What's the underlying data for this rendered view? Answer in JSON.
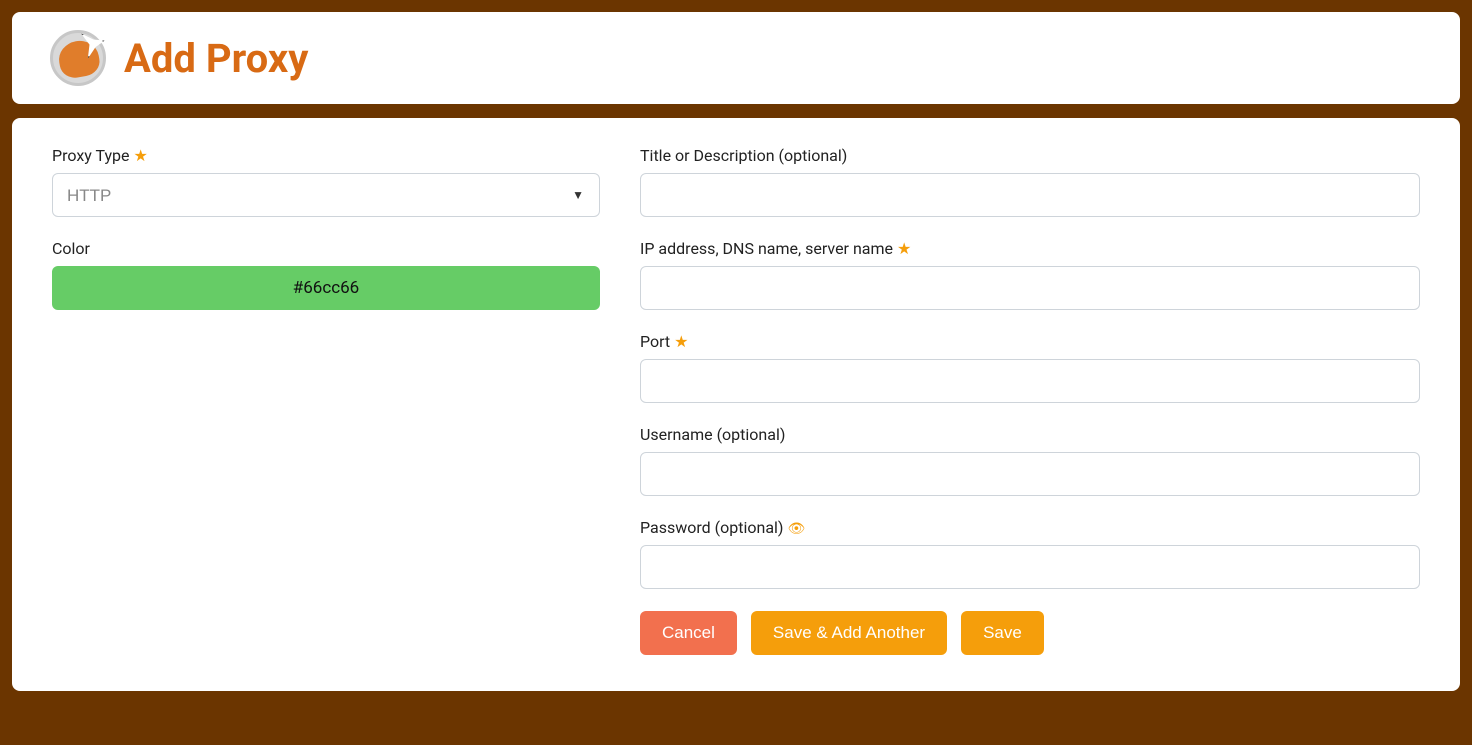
{
  "header": {
    "title": "Add Proxy"
  },
  "form": {
    "left": {
      "proxy_type": {
        "label": "Proxy Type",
        "required": true,
        "value": "HTTP"
      },
      "color": {
        "label": "Color",
        "value": "#66cc66",
        "swatch_bg": "#66cc66"
      }
    },
    "right": {
      "title": {
        "label": "Title or Description (optional)",
        "required": false,
        "value": ""
      },
      "address": {
        "label": "IP address, DNS name, server name",
        "required": true,
        "value": ""
      },
      "port": {
        "label": "Port",
        "required": true,
        "value": ""
      },
      "username": {
        "label": "Username (optional)",
        "required": false,
        "value": ""
      },
      "password": {
        "label": "Password (optional)",
        "required": false,
        "show_toggle": true,
        "value": ""
      }
    },
    "buttons": {
      "cancel": "Cancel",
      "save_add_another": "Save & Add Another",
      "save": "Save"
    }
  }
}
